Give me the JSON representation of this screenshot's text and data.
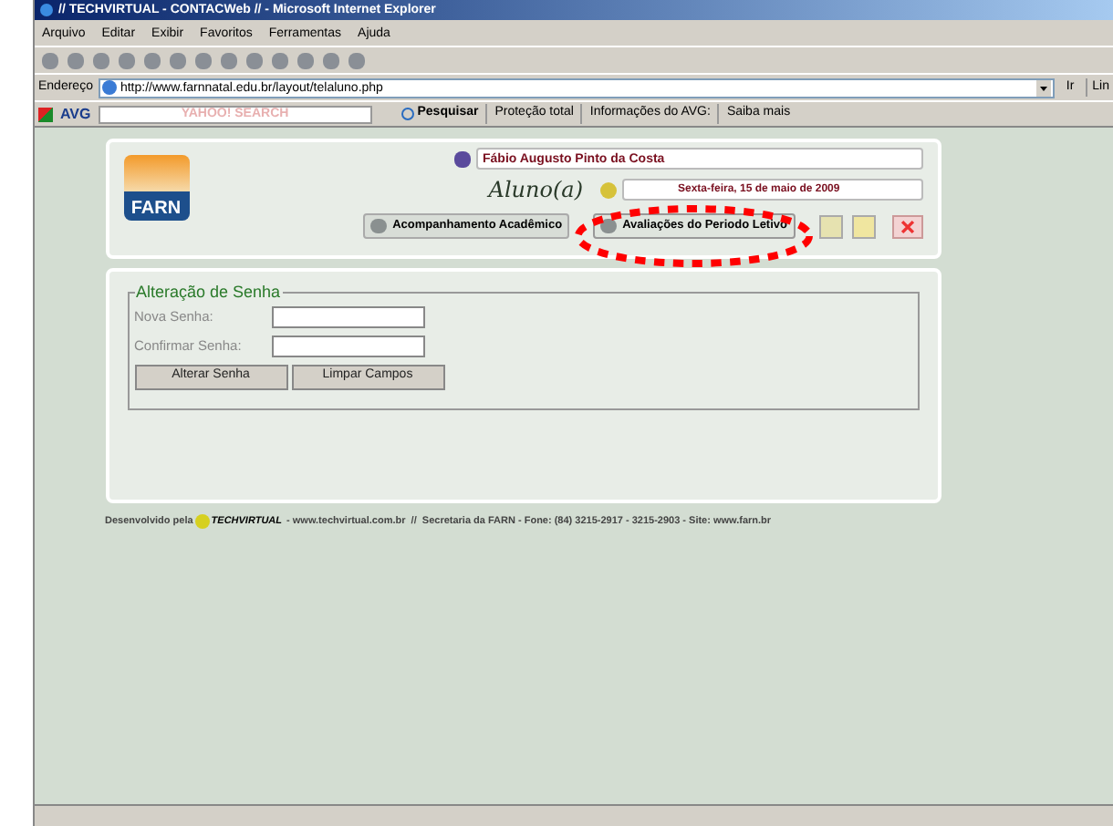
{
  "window": {
    "title": "// TECHVIRTUAL - CONTACWeb // - Microsoft Internet Explorer"
  },
  "menu": [
    "Arquivo",
    "Editar",
    "Exibir",
    "Favoritos",
    "Ferramentas",
    "Ajuda"
  ],
  "address_bar": {
    "label": "Endereço",
    "value": "http://www.farnnatal.edu.br/layout/telaluno.php",
    "go": "Ir",
    "links": "Lin"
  },
  "avg_toolbar": {
    "brand": "AVG",
    "search_placeholder": "YAHOO! SEARCH",
    "search_button": "Pesquisar",
    "items": [
      "Proteção total",
      "Informações do AVG:",
      "Saiba mais"
    ]
  },
  "header": {
    "logo": "FARN",
    "user_name": "Fábio Augusto Pinto da Costa",
    "role": "Aluno(a)",
    "date": "Sexta-feira, 15 de maio de 2009",
    "nav": [
      {
        "label": "Acompanhamento Acadêmico",
        "highlighted": false
      },
      {
        "label": "Avaliações do Periodo Letivo",
        "highlighted": true
      }
    ]
  },
  "form": {
    "legend": "Alteração de Senha",
    "fields": [
      {
        "label": "Nova Senha:"
      },
      {
        "label": "Confirmar Senha:"
      }
    ],
    "buttons": [
      "Alterar Senha",
      "Limpar Campos"
    ]
  },
  "footer": {
    "prefix": "Desenvolvido pela",
    "brand": "TECHVIRTUAL",
    "text": "- www.techvirtual.com.br  //  Secretaria da FARN - Fone: (84) 3215-2917 - 3215-2903 - Site: www.farn.br"
  }
}
